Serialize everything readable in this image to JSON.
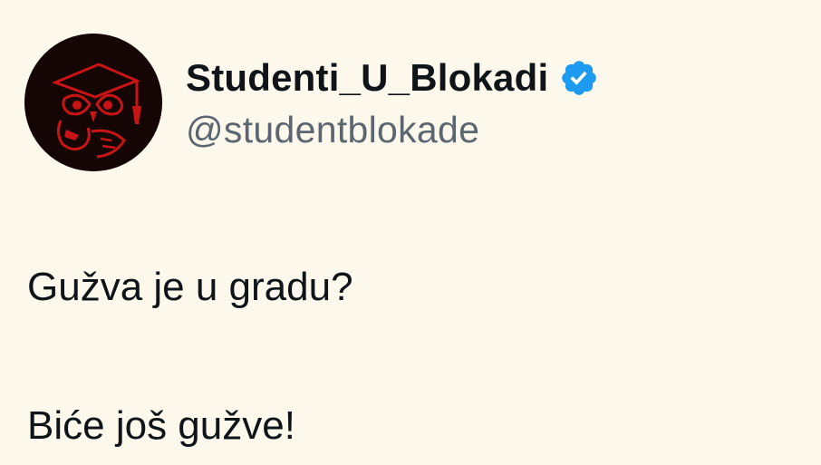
{
  "account": {
    "display_name": "Studenti_U_Blokadi",
    "handle": "@studentblokade",
    "verified": true,
    "verified_color": "#1d9bf0",
    "avatar_icon": "owl-with-graduation-cap-icon",
    "avatar_colors": {
      "background": "#150505",
      "owl": "#c81414"
    }
  },
  "tweet": {
    "lines": [
      "Gužva je u gradu?",
      "Biće još gužve!"
    ]
  }
}
